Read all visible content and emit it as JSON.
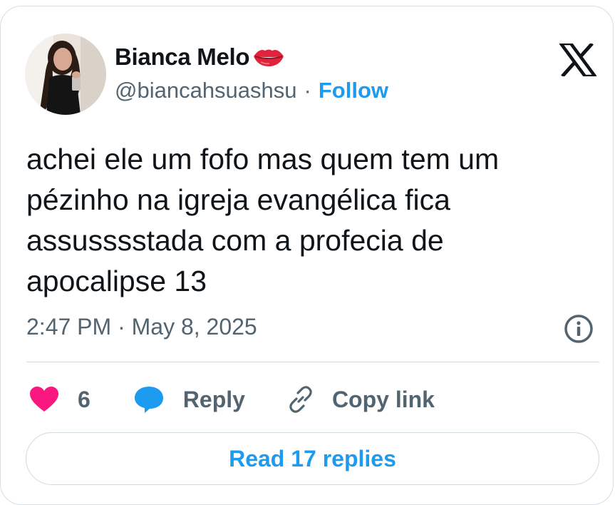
{
  "author": {
    "name": "Bianca Melo",
    "name_emoji": "lips-kiss-emoji",
    "handle": "@biancahsuashsu",
    "separator": "·",
    "follow_label": "Follow"
  },
  "platform_logo": "x-logo",
  "tweet": {
    "lines": [
      "achei ele um fofo mas quem tem um",
      "pézinho na igreja evangélica fica",
      "assusssstada com a profecia de",
      "apocalipse 13"
    ],
    "timestamp": "2:47 PM · May 8, 2025"
  },
  "actions": {
    "like_count": "6",
    "reply_label": "Reply",
    "copy_label": "Copy link"
  },
  "read_replies_label": "Read 17 replies",
  "colors": {
    "accent": "#1d9bf0",
    "like": "#f91880",
    "muted": "#536471",
    "text": "#0f1419"
  }
}
